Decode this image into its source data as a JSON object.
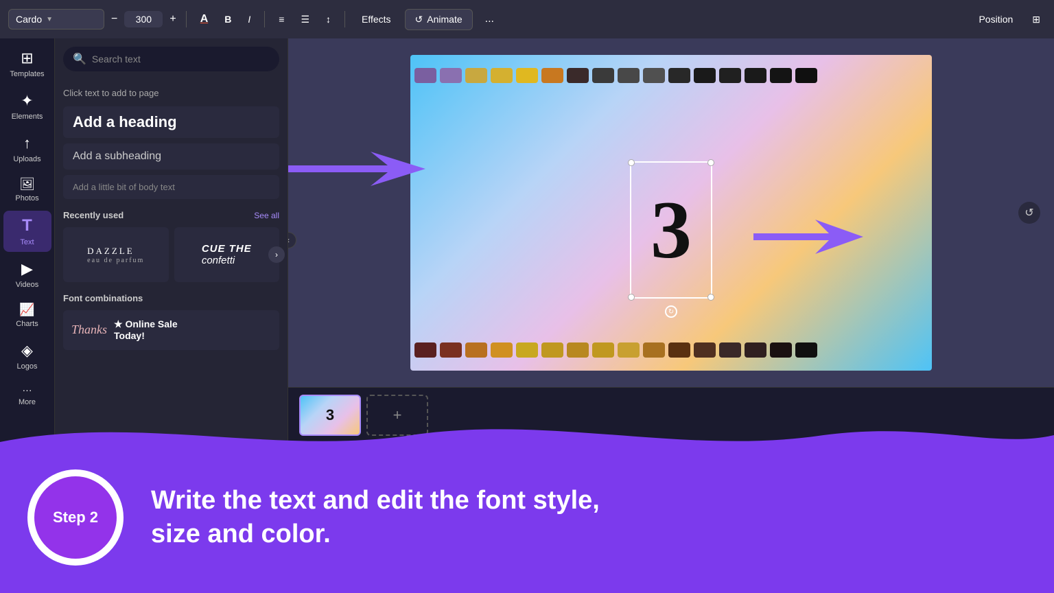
{
  "toolbar": {
    "font_name": "Cardo",
    "font_size": "300",
    "minus_label": "−",
    "plus_label": "+",
    "bold_label": "B",
    "italic_label": "I",
    "align_label": "≡",
    "list_label": "☰",
    "line_height_label": "↕",
    "effects_label": "Effects",
    "animate_label": "Animate",
    "more_label": "...",
    "position_label": "Position",
    "grid_label": "⊞"
  },
  "sidebar": {
    "items": [
      {
        "id": "templates",
        "label": "Templates",
        "icon": "⊞"
      },
      {
        "id": "elements",
        "label": "Elements",
        "icon": "✦"
      },
      {
        "id": "uploads",
        "label": "Uploads",
        "icon": "↑"
      },
      {
        "id": "photos",
        "label": "Photos",
        "icon": "🖼"
      },
      {
        "id": "text",
        "label": "Text",
        "icon": "T"
      },
      {
        "id": "videos",
        "label": "Videos",
        "icon": "▶"
      },
      {
        "id": "charts",
        "label": "Charts",
        "icon": "📈"
      },
      {
        "id": "logos",
        "label": "Logos",
        "icon": "◈"
      },
      {
        "id": "more",
        "label": "More",
        "icon": "···"
      }
    ]
  },
  "left_panel": {
    "search_placeholder": "Search text",
    "click_hint": "Click text to add to page",
    "add_heading": "Add a heading",
    "add_subheading": "Add a subheading",
    "add_body": "Add a little bit of body text",
    "recently_used_label": "Recently used",
    "see_all_label": "See all",
    "font_combinations_label": "Font combinations",
    "font1_line1": "DAZZLE",
    "font1_line2": "eau de parfum",
    "font2_line1": "CUE THE",
    "font2_line2": "confetti",
    "font3_script": "Thanks",
    "font3_bold_line1": "Online Sale",
    "font3_bold_line2": "Today!",
    "font3_star": "★"
  },
  "canvas": {
    "number": "3",
    "slide_num": "3"
  },
  "bottom": {
    "step_label": "Step 2",
    "instruction_line1": "Write the text and edit the font style,",
    "instruction_line2": "size and color."
  },
  "timeline": {
    "add_slide_icon": "+"
  }
}
